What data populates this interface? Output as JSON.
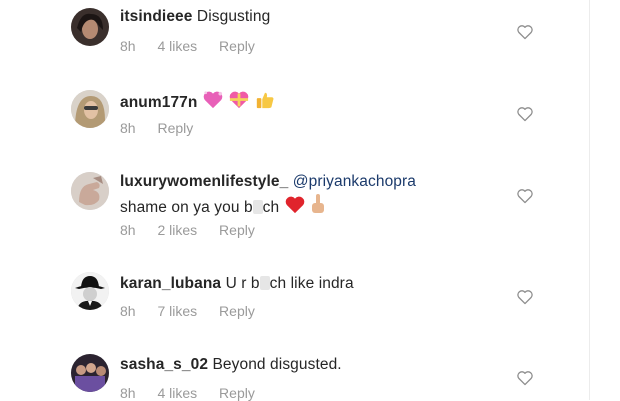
{
  "comments": [
    {
      "username": "itsindieee",
      "text": "Disgusting",
      "time": "8h",
      "likes": "4 likes",
      "reply": "Reply",
      "avatar_icon": "avatar-dark-hair-icon"
    },
    {
      "username": "anum177n",
      "text": "",
      "emojis": [
        "sparkling-heart-icon",
        "heart-ribbon-icon",
        "thumbs-up-icon"
      ],
      "time": "8h",
      "likes": "",
      "reply": "Reply",
      "avatar_icon": "avatar-woman-blonde-icon"
    },
    {
      "username": "luxurywomenlifestyle_",
      "mention": "@priyankachopra",
      "text_a": "shame on ya you b",
      "text_b": "ch",
      "emojis": [
        "red-heart-icon",
        "middle-finger-icon"
      ],
      "time": "8h",
      "likes": "2 likes",
      "reply": "Reply",
      "avatar_icon": "avatar-hand-icon"
    },
    {
      "username": "karan_lubana",
      "text_a": "U r b",
      "text_b": "ch like indra",
      "time": "8h",
      "likes": "7 likes",
      "reply": "Reply",
      "avatar_icon": "avatar-fedora-man-icon"
    },
    {
      "username": "sasha_s_02",
      "text": "Beyond disgusted.",
      "time": "8h",
      "likes": "4 likes",
      "reply": "Reply",
      "avatar_icon": "avatar-group-photo-icon"
    }
  ],
  "colors": {
    "text": "#262626",
    "meta": "#9a9a9a",
    "mention": "#1b3a6b",
    "heart_outline": "#8e8e8e"
  }
}
